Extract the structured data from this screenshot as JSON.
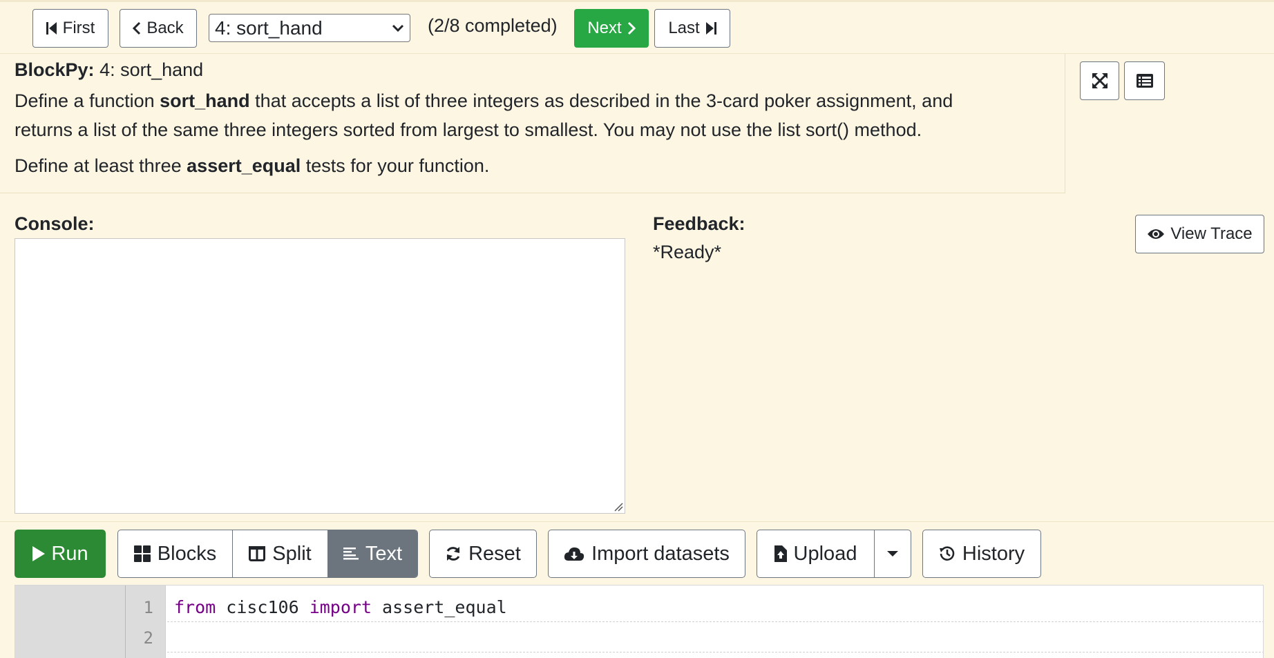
{
  "nav": {
    "first_label": "First",
    "back_label": "Back",
    "assignment_select_value": "4: sort_hand",
    "progress_text": "(2/8 completed)",
    "next_label": "Next",
    "last_label": "Last"
  },
  "description": {
    "brand": "BlockPy:",
    "title": "4: sort_hand",
    "line1_a": "Define a function ",
    "line1_bold": "sort_hand",
    "line1_b": " that accepts a list of three integers as described in the 3-card poker assignment, and",
    "line2": "returns a list of the same three integers sorted from largest to smallest. You may not use the list sort() method.",
    "line3_a": "Define at least three ",
    "line3_bold": "assert_equal",
    "line3_b": " tests for your function.",
    "fullscreen_icon": "expand-icon",
    "list_icon": "list-icon"
  },
  "console": {
    "label": "Console:"
  },
  "feedback": {
    "label": "Feedback:",
    "status": "*Ready*",
    "view_trace_label": "View Trace"
  },
  "toolbar": {
    "run_label": "Run",
    "blocks_label": "Blocks",
    "split_label": "Split",
    "text_label": "Text",
    "reset_label": "Reset",
    "import_label": "Import datasets",
    "upload_label": "Upload",
    "history_label": "History"
  },
  "editor": {
    "line_numbers": [
      "1",
      "2"
    ],
    "line1_kw1": "from",
    "line1_mod": " cisc106 ",
    "line1_kw2": "import",
    "line1_rest": " assert_equal"
  },
  "colors": {
    "run_green": "#2d8a34",
    "next_green": "#28a745",
    "text_active": "#6c757d",
    "background": "#fdf6e3"
  }
}
